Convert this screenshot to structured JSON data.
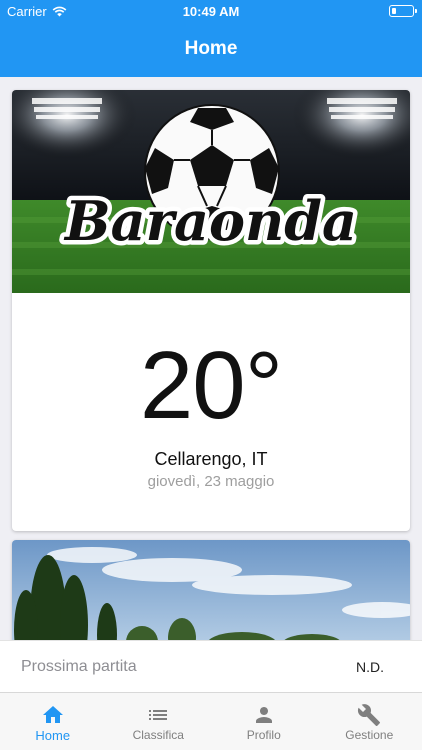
{
  "status_bar": {
    "carrier": "Carrier",
    "time": "10:49 AM"
  },
  "nav": {
    "title": "Home"
  },
  "weather_card": {
    "banner_logo_text": "Baraonda",
    "temperature": "20°",
    "location": "Cellarengo, IT",
    "date": "giovedì, 23 maggio"
  },
  "next_match": {
    "label": "Prossima partita",
    "value": "N.D."
  },
  "tabs": [
    {
      "label": "Home",
      "icon": "home-icon",
      "active": true
    },
    {
      "label": "Classifica",
      "icon": "list-icon",
      "active": false
    },
    {
      "label": "Profilo",
      "icon": "person-icon",
      "active": false
    },
    {
      "label": "Gestione",
      "icon": "wrench-icon",
      "active": false
    }
  ],
  "colors": {
    "accent": "#2196f3",
    "inactive_tab": "#7f7f7f"
  }
}
